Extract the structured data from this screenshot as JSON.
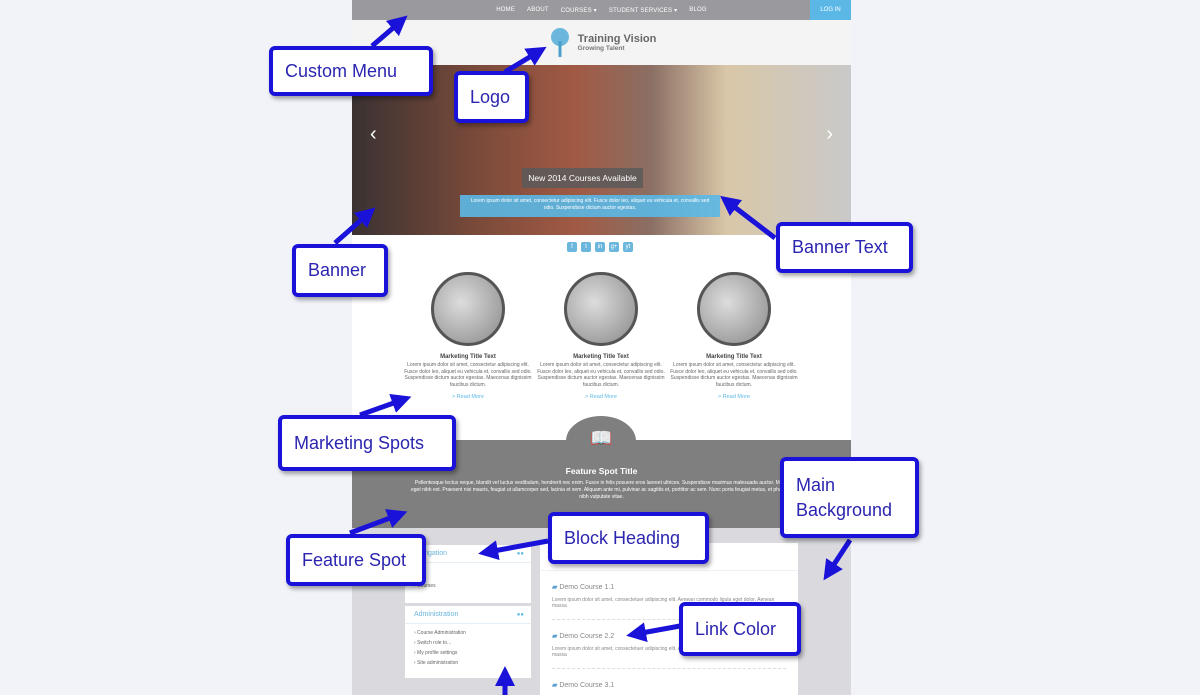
{
  "nav": {
    "items": [
      "HOME",
      "ABOUT",
      "COURSES ▾",
      "STUDENT SERVICES ▾",
      "BLOG"
    ],
    "login": "LOG IN"
  },
  "logo": {
    "name": "Training Vision",
    "tagline": "Growing Talent"
  },
  "banner": {
    "title": "New 2014 Courses Available",
    "text": "Lorem ipsum dolor sit amet, consectetur adipiscing elit. Fusce dolor leo, aliquet eu vehicula et, convallis sed odio. Suspendisse dictum auctor egestas.",
    "prev": "‹",
    "next": "›"
  },
  "social": [
    "f",
    "t",
    "in",
    "g+",
    "yt"
  ],
  "marketing": [
    {
      "title": "Marketing Title Text",
      "text": "Lorem ipsum dolor sit amet, consectetur adipiscing elit. Fusce dolor leo, aliquet eu vehicula et, convallis sed odio. Suspendisse dictum auctor egestas. Maecenas dignissim faucibus dictum.",
      "link": "> Read More"
    },
    {
      "title": "Marketing Title Text",
      "text": "Lorem ipsum dolor sit amet, consectetur adipiscing elit. Fusce dolor leo, aliquet eu vehicula et, convallis sed odio. Suspendisse dictum auctor egestas. Maecenas dignissim faucibus dictum.",
      "link": "> Read More"
    },
    {
      "title": "Marketing Title Text",
      "text": "Lorem ipsum dolor sit amet, consectetur adipiscing elit. Fusce dolor leo, aliquet eu vehicula et, convallis sed odio. Suspendisse dictum auctor egestas. Maecenas dignissim faucibus dictum.",
      "link": "> Read More"
    }
  ],
  "feature": {
    "title": "Feature Spot Title",
    "text": "Pellentesque lectus neque, blandit vel luctus vestibulum, hendrerit nec enim. Fusce in felis posuere eros laoreet ultrices. Suspendisse maximus malesuada auctor. Morbi eget nibh est. Praesent nisi mauris, feugiat ut ullamcorper sed, lacinia et sem. Aliquam ante mi, pulvinar ac sagittis et, porttitor ac sem. Nunc porta feugiat metus, et pharetra nibh vulputate vitae."
  },
  "blocks": {
    "navigation": {
      "title": "Navigation",
      "items": [
        "› Courses"
      ]
    },
    "administration": {
      "title": "Administration",
      "items": [
        "› Course Administration",
        "› Switch role to...",
        "› My profile settings",
        "› Site administration"
      ]
    }
  },
  "courses": [
    {
      "name": "Demo Course 1.1",
      "text": "Lorem ipsum dolor sit amet, consectetuer adipiscing elit. Aenean commodo ligula eget dolor. Aenean massa"
    },
    {
      "name": "Demo Course 2.2",
      "text": "Lorem ipsum dolor sit amet, consectetuer adipiscing elit. Aenean commodo ligula eget dolor. Aenean massa"
    },
    {
      "name": "Demo Course 3.1",
      "text": ""
    }
  ],
  "callouts": {
    "custom_menu": "Custom Menu",
    "logo": "Logo",
    "banner": "Banner",
    "banner_text": "Banner Text",
    "marketing": "Marketing Spots",
    "feature": "Feature Spot",
    "block_heading": "Block Heading",
    "main_bg": "Main Background",
    "link_color": "Link Color"
  },
  "colors": {
    "accent": "#5bb8e6",
    "nav": "#9a9a9e",
    "feature": "#7f7f80",
    "callout_border": "#1a12d8"
  }
}
